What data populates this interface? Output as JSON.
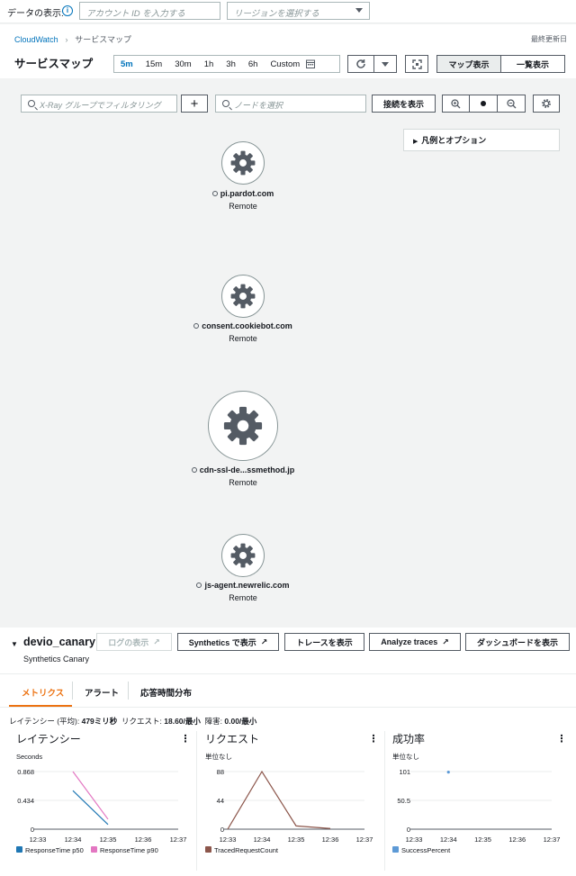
{
  "topbar": {
    "label": "データの表示:",
    "account_placeholder": "アカウント ID を入力する",
    "region_placeholder": "リージョンを選択する"
  },
  "breadcrumb": {
    "home": "CloudWatch",
    "current": "サービスマップ",
    "last_updated": "最終更新日"
  },
  "header": {
    "title": "サービスマップ",
    "time_ranges": [
      "5m",
      "15m",
      "30m",
      "1h",
      "3h",
      "6h",
      "Custom"
    ],
    "selected_range": "5m",
    "map_view": "マップ表示",
    "list_view": "一覧表示"
  },
  "toolbar": {
    "group_placeholder": "X-Ray グループでフィルタリング",
    "add_label": "+",
    "node_placeholder": "ノードを選択",
    "show_connections": "接続を表示",
    "legend_options": "凡例とオプション"
  },
  "nodes": [
    {
      "name": "pi.pardot.com",
      "type": "Remote"
    },
    {
      "name": "consent.cookiebot.com",
      "type": "Remote"
    },
    {
      "name": "cdn-ssl-de...ssmethod.jp",
      "type": "Remote"
    },
    {
      "name": "js-agent.newrelic.com",
      "type": "Remote"
    }
  ],
  "panel": {
    "title": "devio_canary",
    "subtitle": "Synthetics Canary",
    "buttons": {
      "logs": "ログの表示",
      "synthetics": "Synthetics で表示",
      "traces": "トレースを表示",
      "analyze": "Analyze traces",
      "dashboard": "ダッシュボードを表示"
    },
    "tabs": [
      "メトリクス",
      "アラート",
      "応答時間分布"
    ],
    "summary": {
      "latency_label": "レイテンシー (平均):",
      "latency_value": "479ミリ秒",
      "requests_label": "リクエスト:",
      "requests_value": "18.60/最小",
      "faults_label": "障害:",
      "faults_value": "0.00/最小"
    }
  },
  "colors": {
    "accent": "#0073bb",
    "tab_active": "#ec7211",
    "p50": "#1f77b4",
    "p90": "#e377c2",
    "traced": "#8c564b",
    "success": "#5d9ad6"
  },
  "chart_data": [
    {
      "type": "line",
      "title": "レイテンシー",
      "ylabel": "Seconds",
      "y_ticks": [
        "0.868",
        "0.434",
        "0"
      ],
      "ylim": [
        0,
        0.868
      ],
      "x": [
        "12:33",
        "12:34",
        "12:35",
        "12:36",
        "12:37"
      ],
      "series": [
        {
          "name": "ResponseTime p50",
          "values": [
            null,
            0.58,
            0.07,
            null,
            null
          ]
        },
        {
          "name": "ResponseTime p90",
          "values": [
            null,
            0.868,
            0.15,
            null,
            null
          ]
        }
      ]
    },
    {
      "type": "line",
      "title": "リクエスト",
      "ylabel": "単位なし",
      "y_ticks": [
        "88",
        "44",
        "0"
      ],
      "ylim": [
        0,
        88
      ],
      "x": [
        "12:33",
        "12:34",
        "12:35",
        "12:36",
        "12:37"
      ],
      "series": [
        {
          "name": "TracedRequestCount",
          "values": [
            0,
            88,
            5,
            1,
            null
          ]
        }
      ]
    },
    {
      "type": "line",
      "title": "成功率",
      "ylabel": "単位なし",
      "y_ticks": [
        "101",
        "50.5",
        "0"
      ],
      "ylim": [
        0,
        101
      ],
      "x": [
        "12:33",
        "12:34",
        "12:35",
        "12:36",
        "12:37"
      ],
      "series": [
        {
          "name": "SuccessPercent",
          "values": [
            null,
            100,
            null,
            null,
            null
          ]
        }
      ]
    }
  ]
}
